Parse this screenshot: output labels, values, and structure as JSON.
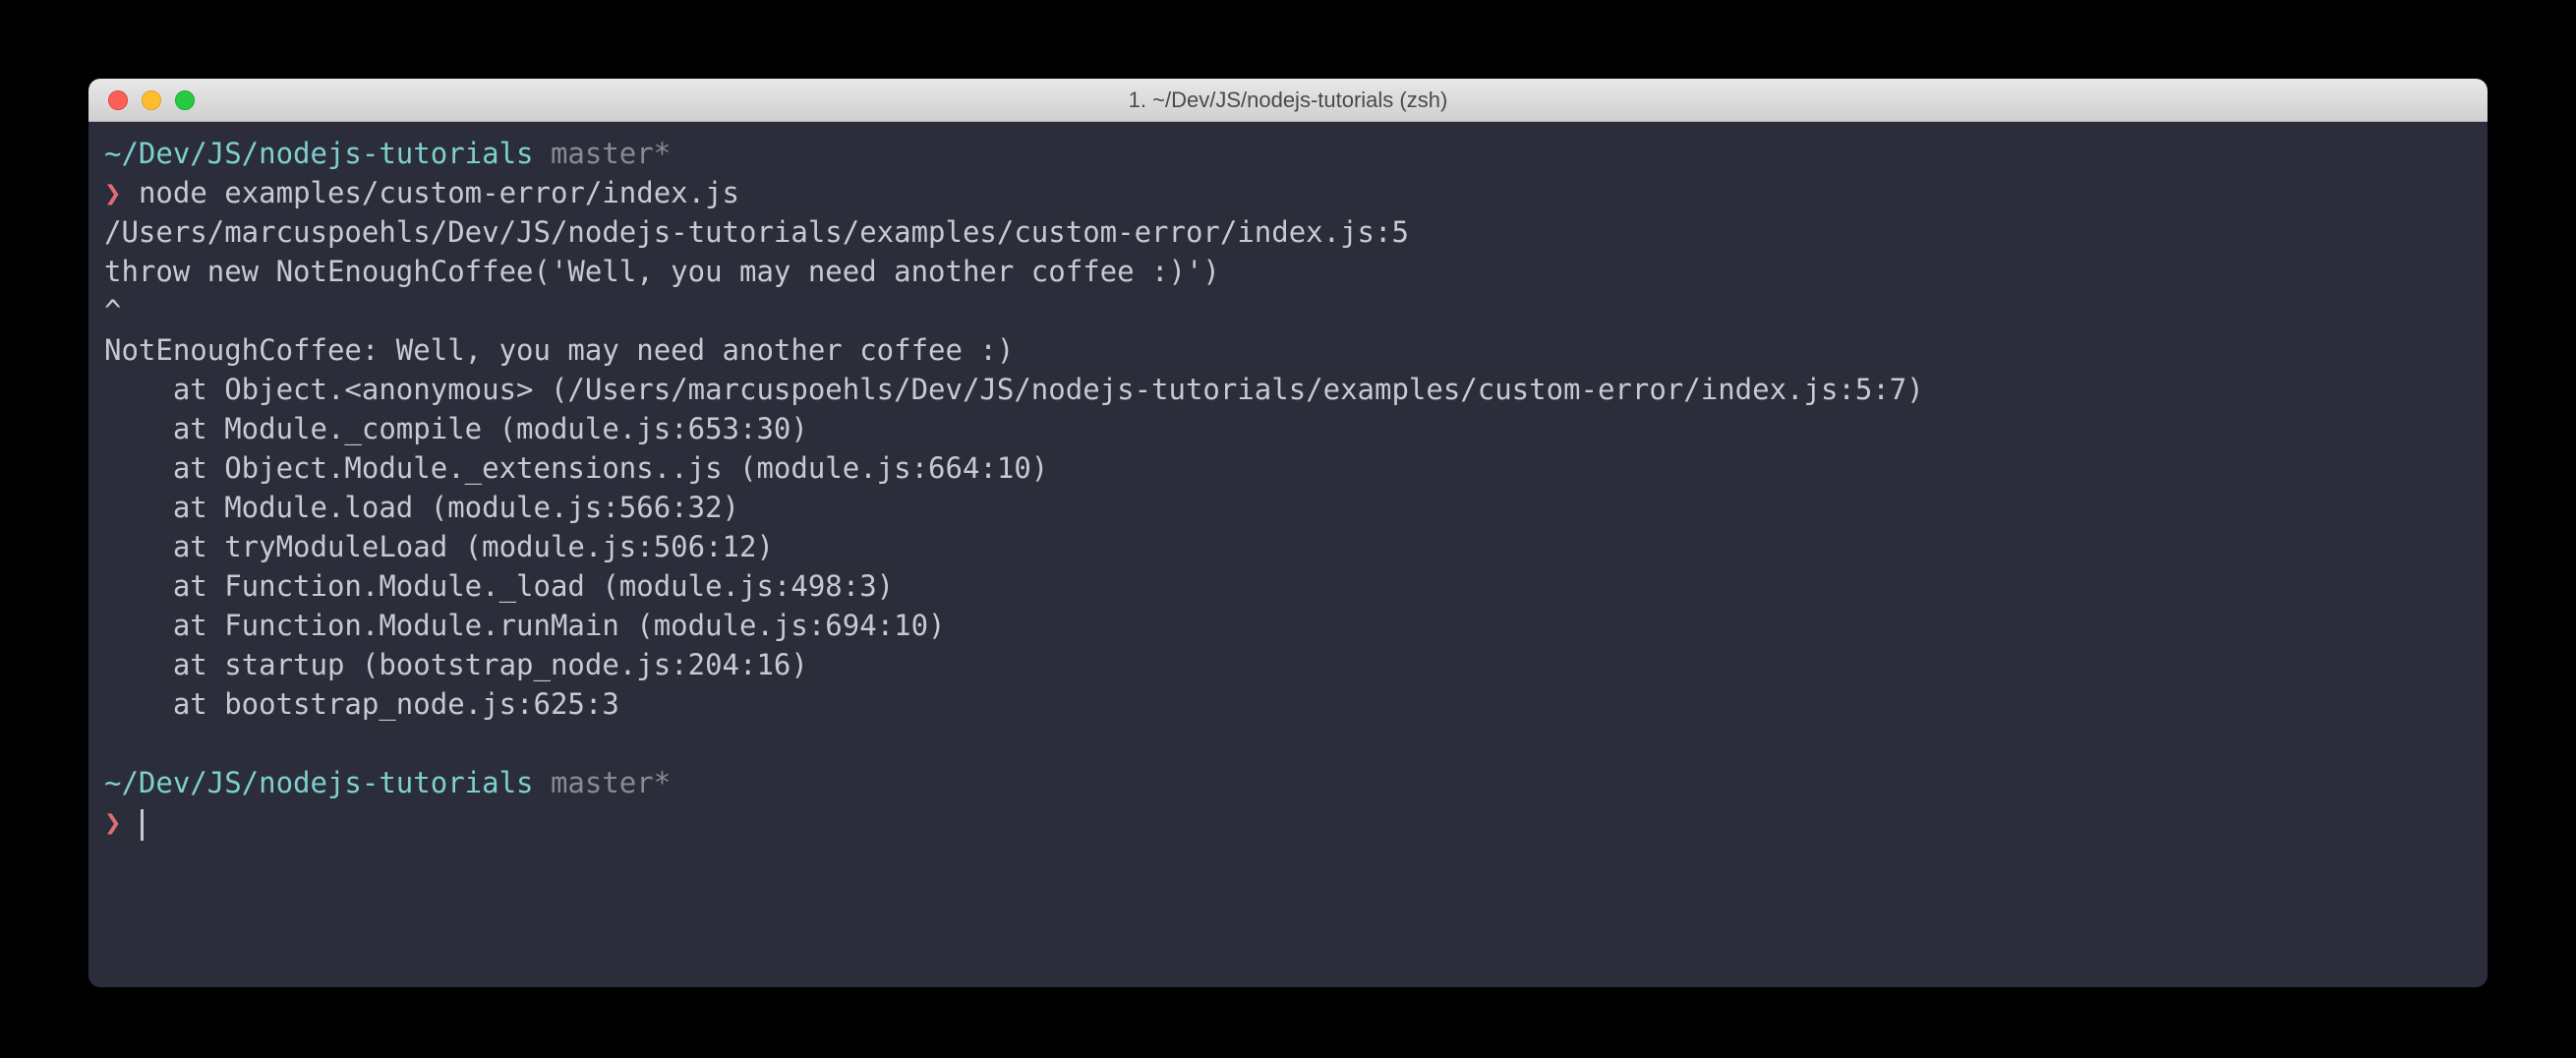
{
  "window": {
    "title": "1. ~/Dev/JS/nodejs-tutorials (zsh)"
  },
  "prompt1": {
    "path": "~/Dev/JS/nodejs-tutorials",
    "branch": "master*",
    "symbol": "❯",
    "command": "node examples/custom-error/index.js"
  },
  "output": {
    "l1": "/Users/marcuspoehls/Dev/JS/nodejs-tutorials/examples/custom-error/index.js:5",
    "l2": "throw new NotEnoughCoffee('Well, you may need another coffee :)')",
    "l3": "^",
    "l4": "",
    "l5": "NotEnoughCoffee: Well, you may need another coffee :)",
    "l6": "    at Object.<anonymous> (/Users/marcuspoehls/Dev/JS/nodejs-tutorials/examples/custom-error/index.js:5:7)",
    "l7": "    at Module._compile (module.js:653:30)",
    "l8": "    at Object.Module._extensions..js (module.js:664:10)",
    "l9": "    at Module.load (module.js:566:32)",
    "l10": "    at tryModuleLoad (module.js:506:12)",
    "l11": "    at Function.Module._load (module.js:498:3)",
    "l12": "    at Function.Module.runMain (module.js:694:10)",
    "l13": "    at startup (bootstrap_node.js:204:16)",
    "l14": "    at bootstrap_node.js:625:3"
  },
  "prompt2": {
    "path": "~/Dev/JS/nodejs-tutorials",
    "branch": "master*",
    "symbol": "❯"
  }
}
